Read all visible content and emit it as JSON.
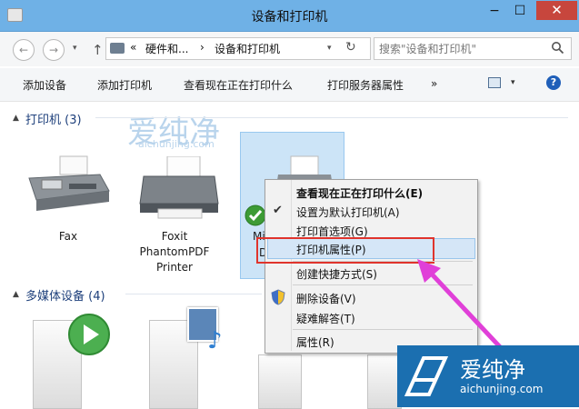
{
  "window": {
    "title": "设备和打印机",
    "minimize": "−",
    "maximize": "☐",
    "close": "✕"
  },
  "nav": {
    "back": "←",
    "forward": "→",
    "up": "↑",
    "refresh": "↻",
    "dropdown": "▾"
  },
  "address": {
    "sep": "«",
    "crumb1": "硬件和...",
    "arrow": "›",
    "crumb2": "设备和打印机",
    "search_placeholder": "搜索\"设备和打印机\""
  },
  "toolbar": {
    "add_device": "添加设备",
    "add_printer": "添加打印机",
    "see_printing": "查看现在正在打印什么",
    "print_server": "打印服务器属性",
    "more": "»",
    "help": "?"
  },
  "groups": {
    "printers": {
      "label": "打印机 (3)"
    },
    "multimedia": {
      "label": "多媒体设备 (4)"
    }
  },
  "devices": [
    {
      "label": "Fax"
    },
    {
      "label": "Foxit PhantomPDF Printer"
    },
    {
      "label": "Mi"
    },
    {
      "label": "D"
    }
  ],
  "context_menu": {
    "items": [
      {
        "label": "查看现在正在打印什么(E)"
      },
      {
        "label": "设置为默认打印机(A)"
      },
      {
        "label": "打印首选项(G)"
      },
      {
        "label": "打印机属性(P)"
      },
      {
        "label": "创建快捷方式(S)"
      },
      {
        "label": "删除设备(V)"
      },
      {
        "label": "疑难解答(T)"
      },
      {
        "label": "属性(R)"
      }
    ]
  },
  "watermark": {
    "text_cn": "爱纯净",
    "text_url": "aichunjing.com"
  },
  "colors": {
    "titlebar": "#6fb1e6",
    "close": "#c7463d",
    "highlight_box": "#e0342c",
    "arrow": "#e040d8"
  }
}
